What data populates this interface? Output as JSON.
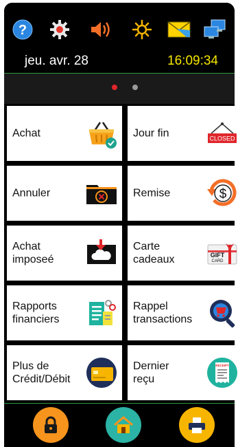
{
  "status_bar": {
    "icons": [
      "help-icon",
      "settings-gear-icon",
      "volume-icon",
      "brightness-icon",
      "mail-icon",
      "network-icon"
    ],
    "date": "jeu. avr. 28",
    "time": "16:09:34"
  },
  "pager": {
    "pages": 2,
    "active": 1
  },
  "tiles": [
    {
      "label": "Achat",
      "icon": "shopping-basket-icon"
    },
    {
      "label": "Jour fin",
      "icon": "closed-sign-icon",
      "icon_text": "CLOSED"
    },
    {
      "label": "Annuler",
      "icon": "cancel-folder-icon"
    },
    {
      "label": "Remise",
      "icon": "refund-dollar-icon"
    },
    {
      "label": "Achat\nimposeé",
      "icon": "cloud-download-icon"
    },
    {
      "label": "Carte\ncadeaux",
      "icon": "gift-card-icon",
      "icon_text": "GIFT",
      "icon_subtext": "CARD"
    },
    {
      "label": "Rapports\nfinanciers",
      "icon": "financial-report-icon"
    },
    {
      "label": "Rappel\ntransactions",
      "icon": "search-cart-icon"
    },
    {
      "label": "Plus de\nCrédit/Débit",
      "icon": "credit-card-icon"
    },
    {
      "label": "Dernier\nreçu",
      "icon": "receipt-icon",
      "icon_text": "RECEIPT"
    }
  ],
  "bottom_bar": {
    "buttons": [
      "lock-icon",
      "home-icon",
      "printer-icon"
    ]
  },
  "colors": {
    "accent_green": "#2f9a3f",
    "time_yellow": "#f6e600",
    "orange": "#f7941d",
    "teal": "#2bb3a5",
    "navy": "#1f2f5a"
  }
}
